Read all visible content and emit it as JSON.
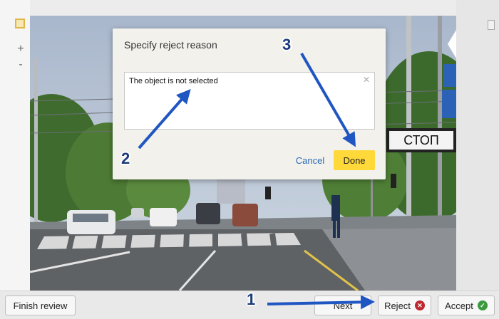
{
  "modal": {
    "title": "Specify reject reason",
    "reason_value": "The object is not selected",
    "cancel_label": "Cancel",
    "done_label": "Done"
  },
  "toolbar": {
    "zoom_in_label": "+",
    "zoom_out_label": "-"
  },
  "bottom_bar": {
    "finish_label": "Finish review",
    "next_label": "Next",
    "reject_label": "Reject",
    "accept_label": "Accept"
  },
  "photo": {
    "stop_sign_text": "СТОП"
  },
  "annotations": {
    "step1": "1",
    "step2": "2",
    "step3": "3"
  },
  "colors": {
    "done_button": "#ffd83a",
    "reject_icon": "#c0262f",
    "accept_icon": "#3a9a3d",
    "annotation_arrow": "#1f56c2"
  }
}
